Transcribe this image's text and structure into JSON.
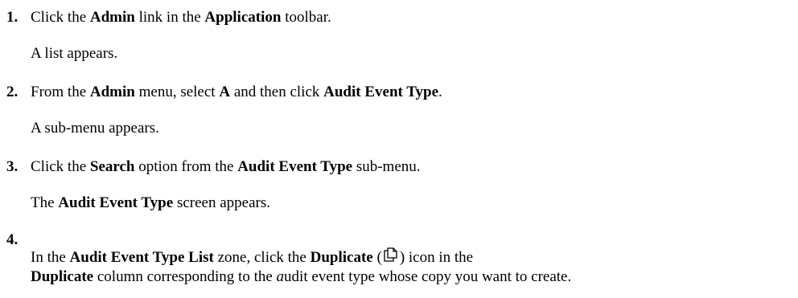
{
  "steps": [
    {
      "number": "1.",
      "instruction": {
        "p1": "Click the ",
        "b1": "Admin",
        "p2": " link in the ",
        "b2": "Application",
        "p3": " toolbar."
      },
      "result": "A list appears."
    },
    {
      "number": "2.",
      "instruction": {
        "p1": "From the ",
        "b1": "Admin",
        "p2": " menu, select ",
        "b2": "A",
        "p3": " and then click ",
        "b3": "Audit Event Type",
        "p4": "."
      },
      "result": "A sub-menu appears."
    },
    {
      "number": "3.",
      "instruction": {
        "p1": "Click the ",
        "b1": "Search",
        "p2": " option from the ",
        "b2": "Audit Event Type",
        "p3": " sub-menu."
      },
      "result": {
        "p1": "The ",
        "b1": "Audit Event Type",
        "p2": " screen appears."
      }
    },
    {
      "number": "4.",
      "instruction": {
        "p1": "In the ",
        "b1": "Audit Event Type List",
        "p2": " zone, click the ",
        "b2": "Duplicate",
        "p3": " (",
        "icon": "duplicate-icon",
        "p4": ") icon in the",
        "b3": "Duplicate",
        "p5": " column corresponding to the ",
        "i1": "a",
        "p6": "udit event type whose copy you want to create."
      }
    }
  ]
}
